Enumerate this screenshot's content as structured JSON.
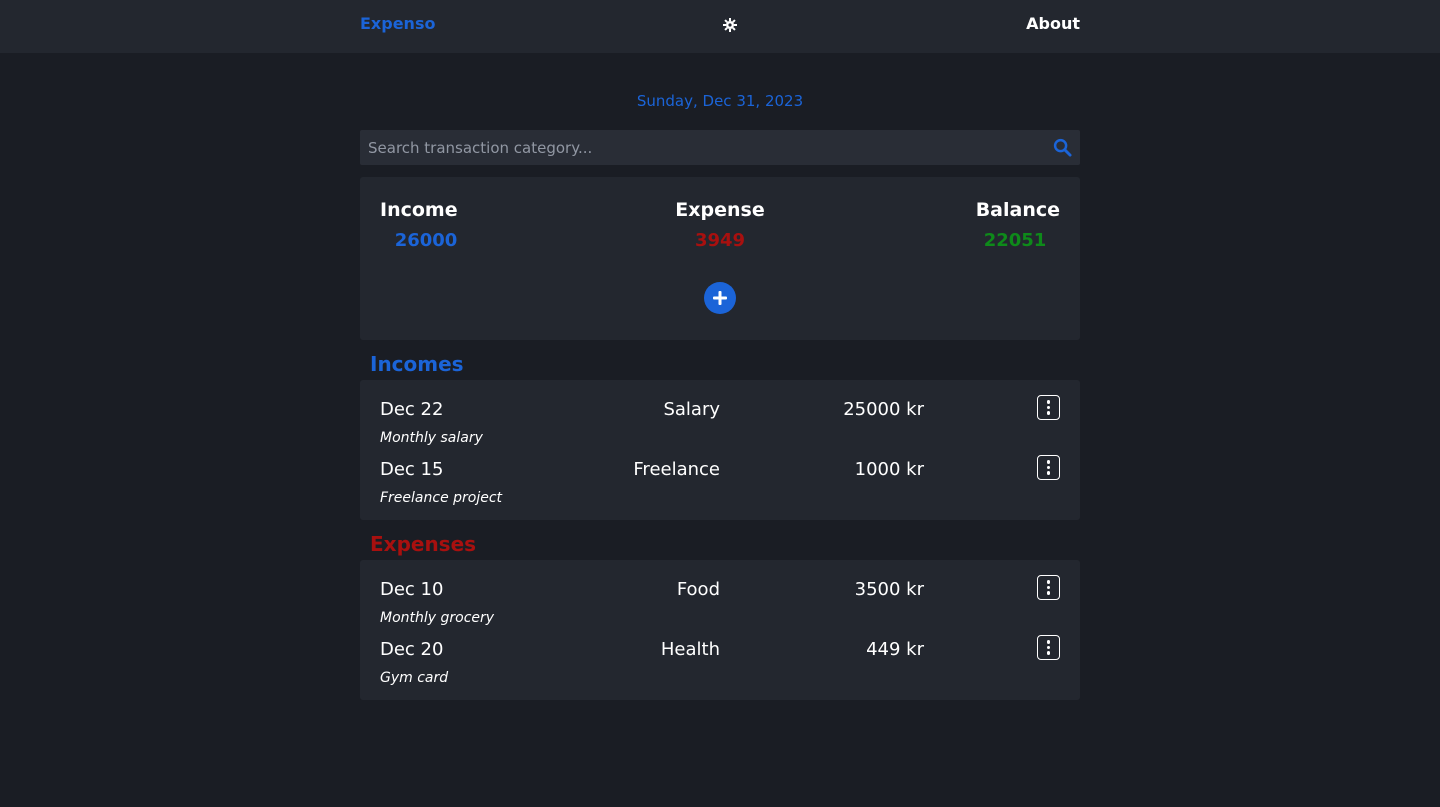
{
  "nav": {
    "brand": "Expenso",
    "theme_icon": "gear-icon",
    "about": "About"
  },
  "date": "Sunday, Dec 31, 2023",
  "search": {
    "placeholder": "Search transaction category...",
    "value": "",
    "icon": "search-icon"
  },
  "summary": {
    "income_label": "Income",
    "income_value": "26000",
    "expense_label": "Expense",
    "expense_value": "3949",
    "balance_label": "Balance",
    "balance_value": "22051",
    "add_icon": "plus-icon"
  },
  "incomes": {
    "title": "Incomes",
    "items": [
      {
        "date": "Dec 22",
        "category": "Salary",
        "amount": "25000 kr",
        "note": "Monthly salary"
      },
      {
        "date": "Dec 15",
        "category": "Freelance",
        "amount": "1000 kr",
        "note": "Freelance project"
      }
    ]
  },
  "expenses": {
    "title": "Expenses",
    "items": [
      {
        "date": "Dec 10",
        "category": "Food",
        "amount": "3500 kr",
        "note": "Monthly grocery"
      },
      {
        "date": "Dec 20",
        "category": "Health",
        "amount": "449 kr",
        "note": "Gym card"
      }
    ]
  },
  "colors": {
    "accent_blue": "#1b64d8",
    "expense_red": "#a8100f",
    "balance_green": "#0e8a1a",
    "background": "#1a1d24",
    "card": "#23272f"
  }
}
